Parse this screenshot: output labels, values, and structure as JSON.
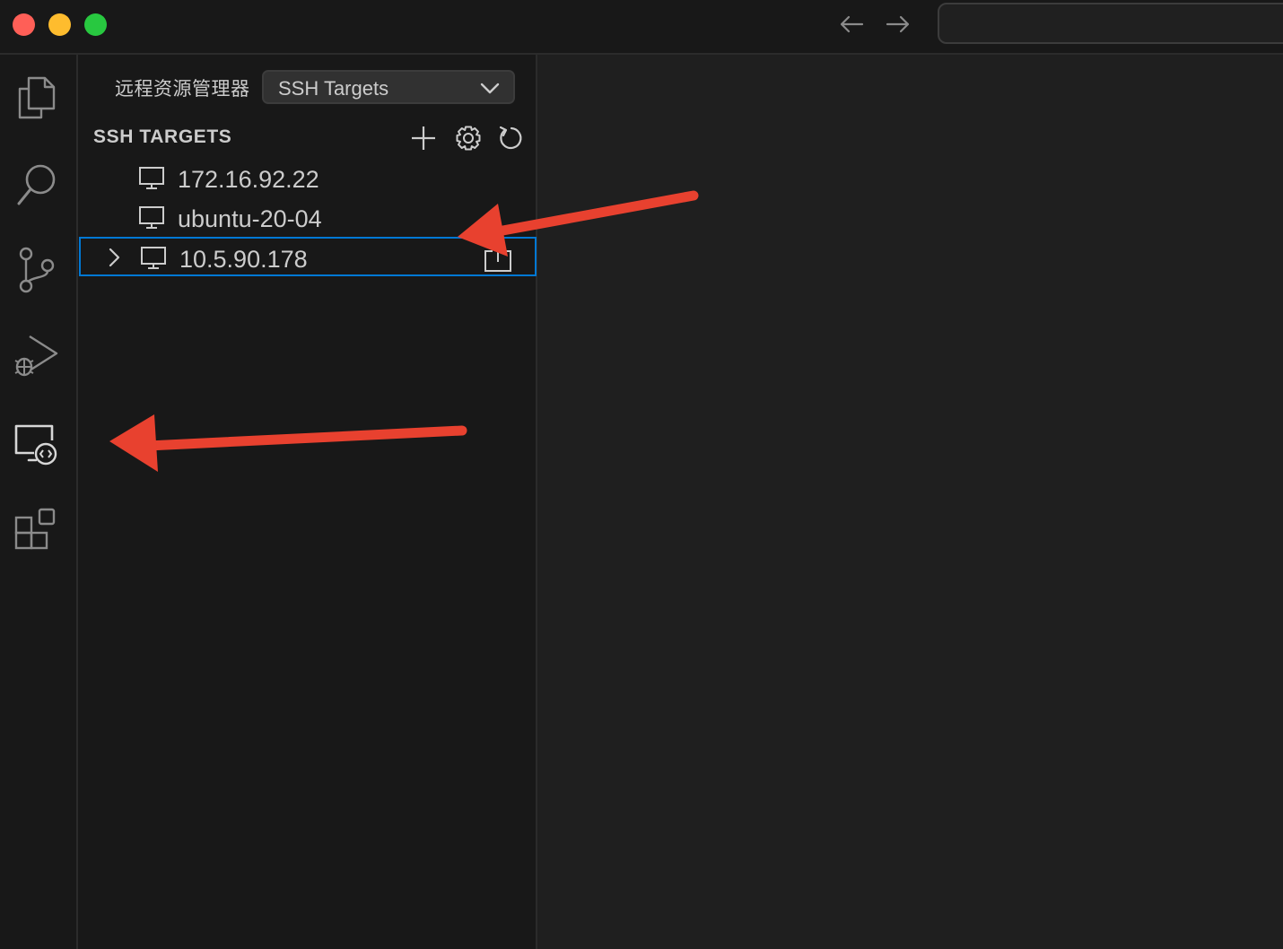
{
  "window": {
    "traffic_lights": [
      "close",
      "minimize",
      "maximize"
    ],
    "nav": {
      "back_icon": "arrow-left-icon",
      "forward_icon": "arrow-right-icon"
    },
    "command_center_text": ""
  },
  "activity_bar": {
    "items": [
      {
        "id": "explorer",
        "icon": "files-icon"
      },
      {
        "id": "search",
        "icon": "search-icon"
      },
      {
        "id": "source-control",
        "icon": "source-control-icon"
      },
      {
        "id": "run-debug",
        "icon": "run-debug-icon"
      },
      {
        "id": "remote-explorer",
        "icon": "remote-explorer-icon",
        "active": true
      },
      {
        "id": "extensions",
        "icon": "extensions-icon"
      }
    ]
  },
  "sidebar": {
    "title": "远程资源管理器",
    "view_select": {
      "value": "SSH Targets"
    },
    "section": {
      "title": "SSH TARGETS",
      "actions": [
        {
          "id": "add",
          "icon": "plus-icon"
        },
        {
          "id": "configure",
          "icon": "gear-icon"
        },
        {
          "id": "refresh",
          "icon": "refresh-icon"
        }
      ]
    },
    "hosts": [
      {
        "label": "172.16.92.22",
        "icon": "monitor-icon",
        "expandable": false,
        "selected": false
      },
      {
        "label": "ubuntu-20-04",
        "icon": "monitor-icon",
        "expandable": false,
        "selected": false
      },
      {
        "label": "10.5.90.178",
        "icon": "monitor-icon",
        "expandable": true,
        "selected": true,
        "action_icon": "open-in-new-window-icon"
      }
    ]
  },
  "annotations": {
    "arrow_color": "#e8412f",
    "arrows": [
      "pointing-to-selected-host-action",
      "pointing-to-remote-explorer"
    ]
  },
  "colors": {
    "accent": "#0078d4",
    "background": "#1f1f1f",
    "sidebar": "#181818",
    "text": "#cccccc"
  }
}
